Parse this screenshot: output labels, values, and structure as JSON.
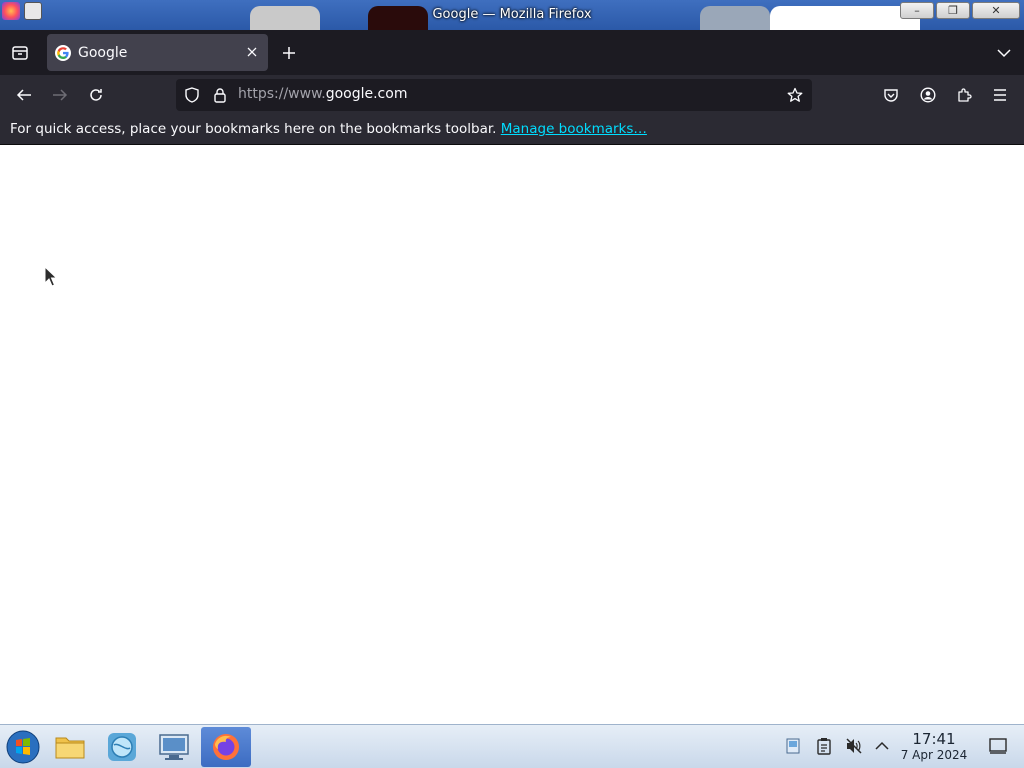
{
  "window": {
    "title": "Google — Mozilla Firefox",
    "buttons": {
      "minimize": "–",
      "maximize": "❐",
      "close": "✕"
    }
  },
  "tabs": [
    {
      "title": "Google",
      "favicon": "google-g-icon",
      "active": true
    }
  ],
  "toolbar_icons": [
    "tab-overview-icon",
    "new-tab-icon",
    "list-all-tabs-icon"
  ],
  "navbar": {
    "url_prefix": "https://www.",
    "url_domain": "google.com",
    "icons": [
      "back-icon",
      "forward-icon",
      "reload-icon",
      "tracking-shield-icon",
      "lock-icon",
      "bookmark-star-icon",
      "pocket-icon",
      "account-icon",
      "extensions-icon",
      "menu-icon"
    ]
  },
  "bookmarks_toolbar": {
    "message": "For quick access, place your bookmarks here on the bookmarks toolbar.",
    "link": "Manage bookmarks…"
  },
  "taskbar": {
    "apps": [
      "start-button",
      "file-manager",
      "browser-globe",
      "system-settings",
      "firefox"
    ],
    "active_app": "firefox",
    "tray_icons": [
      "network-icon",
      "clipboard-icon",
      "volume-muted-icon",
      "tray-expand-icon",
      "show-desktop-icon"
    ],
    "clock": {
      "time": "17:41",
      "date": "7 Apr 2024"
    }
  },
  "colors": {
    "tabstrip_bg": "#1c1b22",
    "navbar_bg": "#2b2a33",
    "link": "#00ddff",
    "taskbar_active": "#3c6cc2"
  }
}
